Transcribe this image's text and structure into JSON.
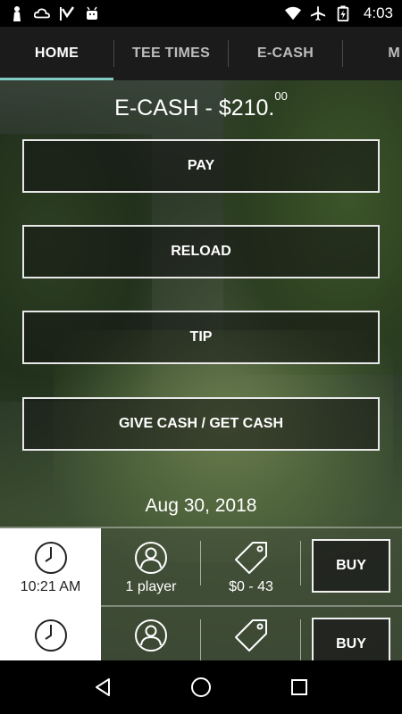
{
  "status_bar": {
    "time": "4:03",
    "left_icons": [
      "person-silhouette-icon",
      "cloud-icon",
      "check-flag-icon",
      "android-icon"
    ],
    "right_icons": [
      "wifi-icon",
      "airplane-mode-icon",
      "battery-charging-icon"
    ]
  },
  "tabs": [
    {
      "label": "HOME",
      "active": true
    },
    {
      "label": "TEE TIMES",
      "active": false
    },
    {
      "label": "E-CASH",
      "active": false
    },
    {
      "label": "M",
      "active": false
    }
  ],
  "balance": {
    "prefix": "E-CASH - $210.",
    "cents": "00"
  },
  "actions": [
    {
      "label": "PAY"
    },
    {
      "label": "RELOAD"
    },
    {
      "label": "TIP"
    },
    {
      "label": "GIVE CASH / GET CASH"
    }
  ],
  "date": "Aug 30, 2018",
  "tee_times": [
    {
      "time": "10:21 AM",
      "players": "1 player",
      "price": "$0 - 43",
      "buy_label": "BUY"
    },
    {
      "time": "",
      "players": "",
      "price": "",
      "buy_label": "BUY"
    }
  ],
  "colors": {
    "active_tab_indicator": "#80cbc4",
    "tab_bar_bg": "#1b1b1b"
  }
}
